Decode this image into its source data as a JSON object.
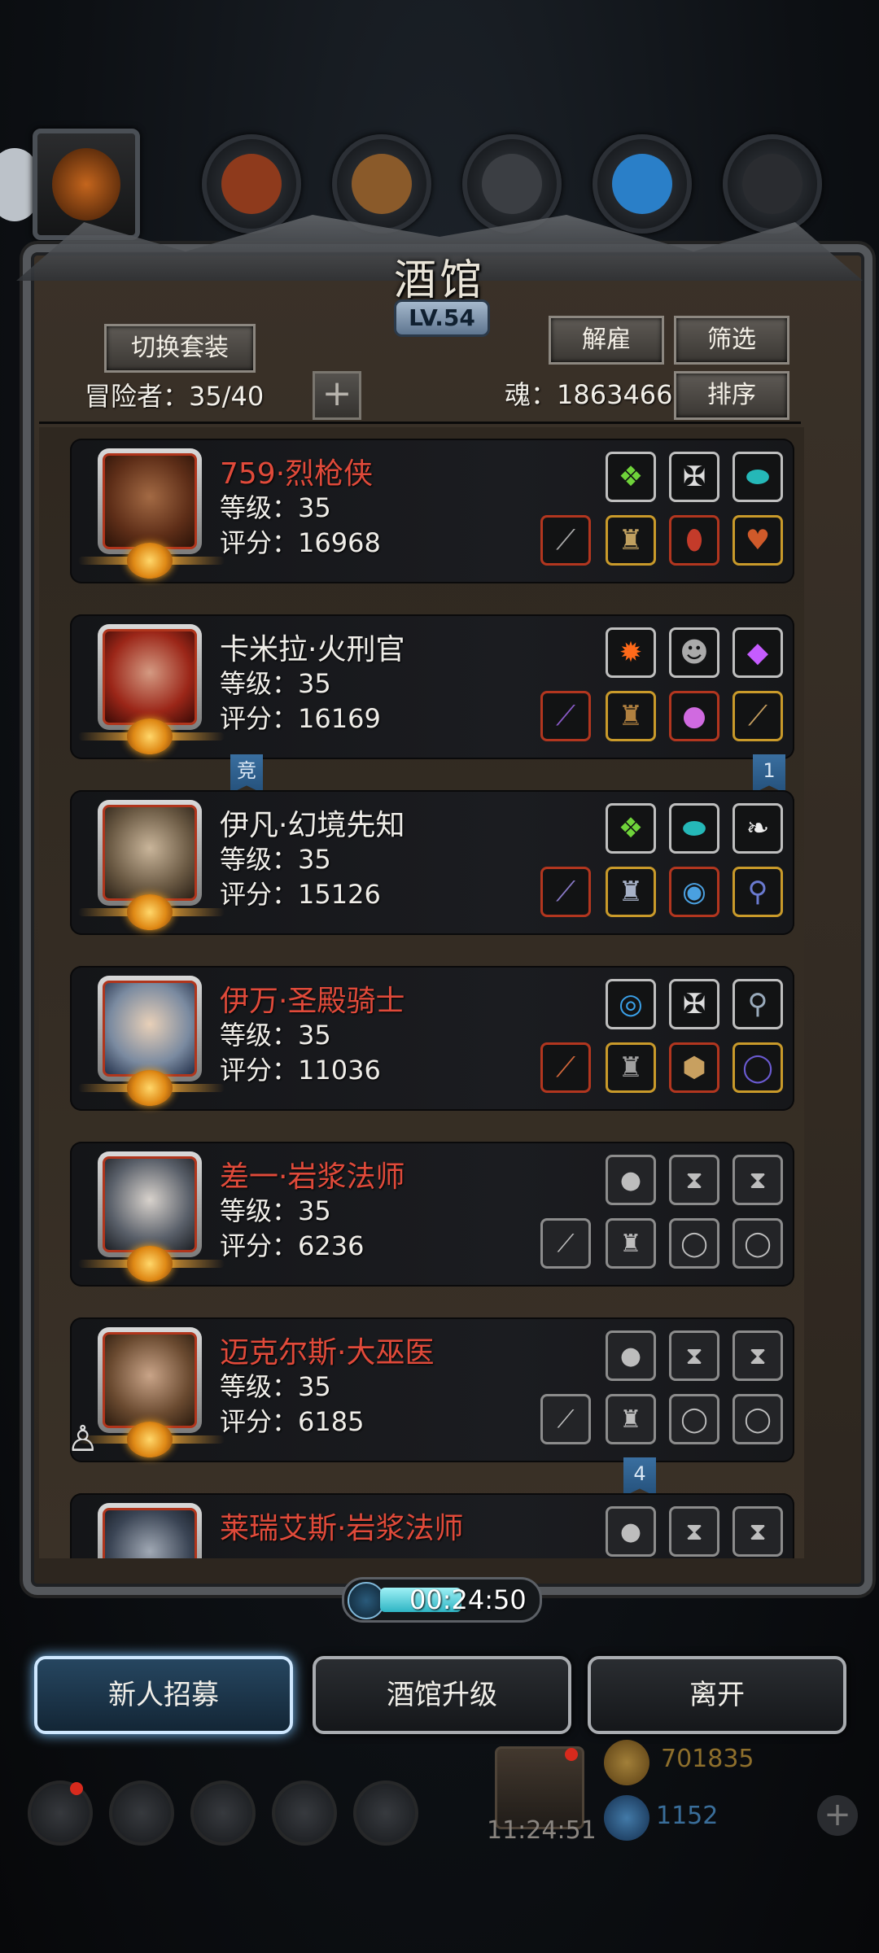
{
  "tavern": {
    "title": "酒馆",
    "level": "LV.54",
    "switch_outfit": "切换套装",
    "dismiss": "解雇",
    "filter": "筛选",
    "sort": "排序",
    "adventurers_label": "冒险者：35/40",
    "soul_label": "魂：1863466",
    "add_symbol": "+"
  },
  "heroes": [
    {
      "name": "759·烈枪侠",
      "level": "等级：35",
      "score": "评分：16968",
      "name_color": "red"
    },
    {
      "name": "卡米拉·火刑官",
      "level": "等级：35",
      "score": "评分：16169",
      "name_color": "white"
    },
    {
      "name": "伊凡·幻境先知",
      "level": "等级：35",
      "score": "评分：15126",
      "name_color": "white"
    },
    {
      "name": "伊万·圣殿骑士",
      "level": "等级：35",
      "score": "评分：11036",
      "name_color": "red"
    },
    {
      "name": "差一·岩浆法师",
      "level": "等级：35",
      "score": "评分：6236",
      "name_color": "red"
    },
    {
      "name": "迈克尔斯·大巫医",
      "level": "等级：35",
      "score": "评分：6185",
      "name_color": "red"
    },
    {
      "name": "莱瑞艾斯·岩浆法师",
      "level": "",
      "score": "",
      "name_color": "red"
    }
  ],
  "tags": {
    "arena": "竞",
    "rank_one": "1",
    "rank_four": "4"
  },
  "timer": "00:24:50",
  "buttons": {
    "recruit": "新人招募",
    "upgrade": "酒馆升级",
    "leave": "离开"
  },
  "resources": {
    "gold": "701835",
    "gems": "1152",
    "gift_timer": "11:24:51"
  },
  "colors": {
    "name_red": "#e04a3a",
    "accent_blue": "#7cc4ff",
    "frame": "#55585c"
  }
}
